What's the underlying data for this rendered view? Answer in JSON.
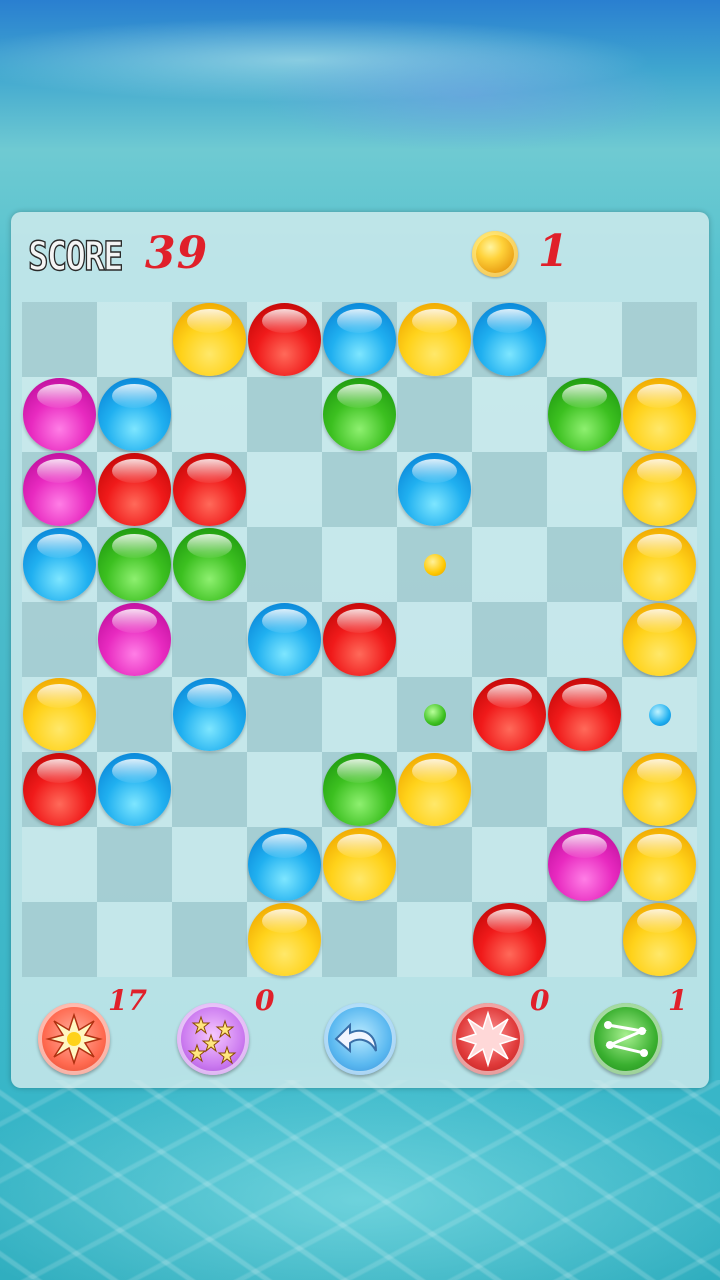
{
  "hud": {
    "score_label": "SCORE",
    "score_value": "39",
    "coin_count": "1"
  },
  "board": {
    "rows": 9,
    "cols": 9,
    "balls": [
      [
        "",
        "",
        "yellow",
        "red",
        "blue",
        "yellow",
        "blue",
        "",
        ""
      ],
      [
        "pink",
        "blue",
        "",
        "",
        "green",
        "",
        "",
        "green",
        "yellow"
      ],
      [
        "pink",
        "red",
        "red",
        "",
        "",
        "blue",
        "",
        "",
        "yellow"
      ],
      [
        "blue",
        "green",
        "green",
        "",
        "",
        "",
        "",
        "",
        "yellow"
      ],
      [
        "",
        "pink",
        "",
        "blue",
        "red",
        "",
        "",
        "",
        "yellow"
      ],
      [
        "yellow",
        "",
        "blue",
        "",
        "",
        "",
        "red",
        "red",
        ""
      ],
      [
        "red",
        "blue",
        "",
        "",
        "green",
        "yellow",
        "",
        "",
        "yellow"
      ],
      [
        "",
        "",
        "",
        "blue",
        "yellow",
        "",
        "",
        "pink",
        "yellow"
      ],
      [
        "",
        "",
        "",
        "yellow",
        "",
        "",
        "red",
        "",
        "yellow"
      ]
    ],
    "next_balls": [
      {
        "row": 3,
        "col": 5,
        "color": "yellow"
      },
      {
        "row": 5,
        "col": 5,
        "color": "green"
      },
      {
        "row": 5,
        "col": 8,
        "color": "blue"
      }
    ]
  },
  "tools": {
    "bomb_count": "17",
    "scatter_count": "0",
    "blast_count": "0",
    "chain_count": "1",
    "icons": [
      "bomb-icon",
      "scatter-icon",
      "undo-icon",
      "blast-icon",
      "chain-icon"
    ]
  }
}
